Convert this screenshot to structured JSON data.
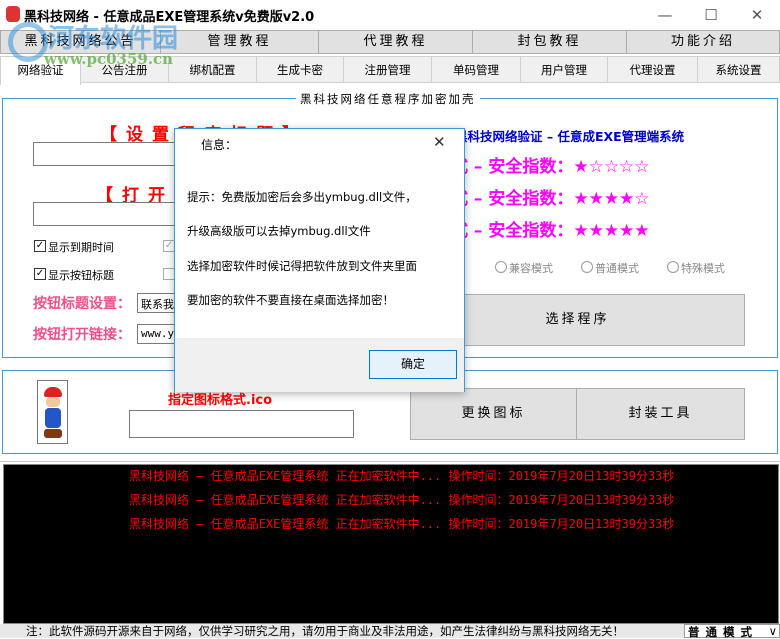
{
  "window": {
    "title": "黑科技网络 - 任意成品EXE管理系统v免费版v2.0",
    "minimize": "—",
    "maximize": "☐",
    "close": "✕"
  },
  "watermark": {
    "name": "河东软件园",
    "url": "www.pc0359.cn"
  },
  "top_buttons": [
    "黑科技网络公告",
    "管理教程",
    "代理教程",
    "封包教程",
    "功能介绍"
  ],
  "tabs": [
    "网络验证",
    "公告注册",
    "绑机配置",
    "生成卡密",
    "注册管理",
    "单码管理",
    "用户管理",
    "代理设置",
    "系统设置"
  ],
  "main_group": {
    "title": "黑科技网络任意程序加密加壳",
    "set_title_label": "【设置程序标题】",
    "open_label": "【打开",
    "checkboxes": [
      {
        "label": "显示到期时间",
        "checked": true
      },
      {
        "label": "显示按钮标题",
        "checked": true
      }
    ],
    "btn_title_label": "按钮标题设置：",
    "btn_title_value": "联系我",
    "btn_link_label": "按钮打开链接：",
    "btn_link_value": "www.ym",
    "brand_line": "黑科技网络验证 – 任意成EXE管理端系统",
    "modes": [
      "兼容模式 – 安全指数：★☆☆☆☆",
      "普通模式 – 安全指数：★★★★☆",
      "特殊模式 – 安全指数：★★★★★"
    ],
    "radios": [
      "兼容模式",
      "普通模式",
      "特殊模式"
    ],
    "select_button": "选择程序"
  },
  "icon_group": {
    "label": "指定图标格式.ico",
    "path_value": "",
    "change_icon": "更换图标",
    "pack_tool": "封装工具"
  },
  "log": [
    "黑科技网络 – 任意成品EXE管理系统 正在加密软件中...  操作时间：2019年7月20日13时39分33秒",
    "黑科技网络 – 任意成品EXE管理系统 正在加密软件中...  操作时间：2019年7月20日13时39分33秒",
    "黑科技网络 – 任意成品EXE管理系统 正在加密软件中...  操作时间：2019年7月20日13时39分33秒"
  ],
  "footer": {
    "note": "注：此软件源码开源来自于网络，仅供学习研究之用，请勿用于商业及非法用途，如产生法律纠纷与黑科技网络无关！",
    "mode_select": "普通模式"
  },
  "dialog": {
    "title": "信息：",
    "close": "✕",
    "lines": [
      "提示：免费版加密后会多出ymbug.dll文件，",
      "升级高级版可以去掉ymbug.dll文件",
      "选择加密软件时候记得把软件放到文件夹里面",
      "要加密的软件不要直接在桌面选择加密！"
    ],
    "ok": "确定"
  }
}
